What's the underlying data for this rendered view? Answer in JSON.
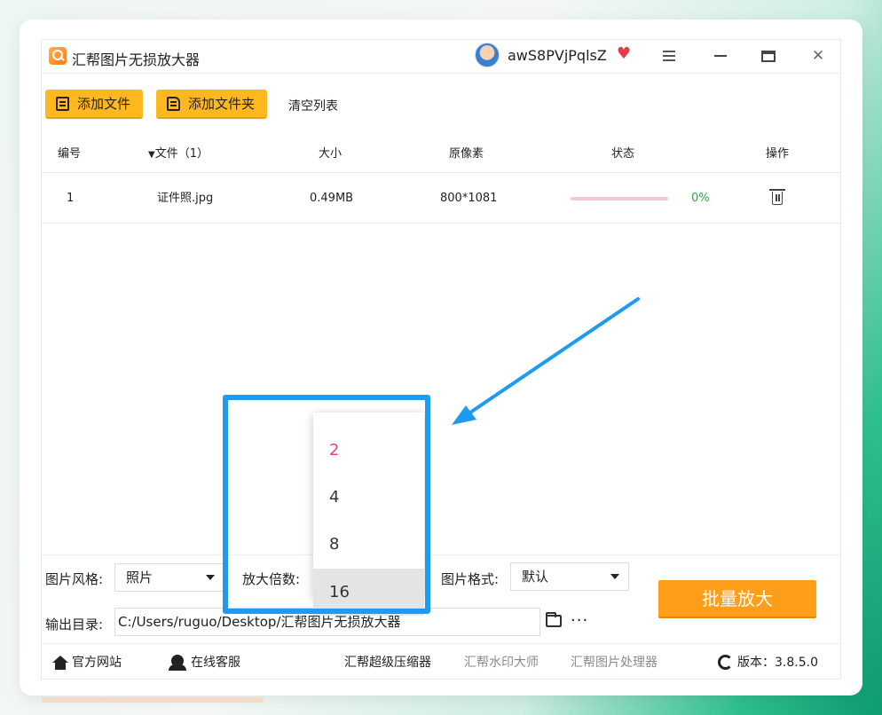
{
  "app": {
    "title": "汇帮图片无损放大器",
    "username": "awS8PVjPqlsZ"
  },
  "toolbar": {
    "add_file": "添加文件",
    "add_folder": "添加文件夹",
    "clear_list": "清空列表"
  },
  "table": {
    "headers": {
      "index": "编号",
      "file": "文件（1）",
      "size": "大小",
      "pixels": "原像素",
      "status": "状态",
      "action": "操作"
    },
    "rows": [
      {
        "index": "1",
        "file": "证件照.jpg",
        "size": "0.49MB",
        "pixels": "800*1081",
        "progress": 0,
        "progress_text": "0%"
      }
    ]
  },
  "settings": {
    "style_label": "图片风格:",
    "style_value": "照片",
    "scale_label": "放大倍数:",
    "format_label": "图片格式:",
    "format_value": "默认",
    "output_label": "输出目录:",
    "output_path": "C:/Users/ruguo/Desktop/汇帮图片无损放大器",
    "more": "···",
    "batch_button": "批量放大"
  },
  "dropdown": {
    "options": [
      "2",
      "4",
      "8",
      "16"
    ],
    "selected": "2",
    "hovered": "16"
  },
  "footer": {
    "website": "官方网站",
    "service": "在线客服",
    "compressor": "汇帮超级压缩器",
    "watermark": "汇帮水印大师",
    "image_processor": "汇帮图片处理器",
    "version": "版本：3.8.5.0"
  },
  "colors": {
    "accent_yellow": "#ffb81f",
    "batch_orange": "#ff9e1b",
    "highlight_blue": "#1d9bf0",
    "progress_pink": "#e6475f",
    "selected_option": "#e0457b"
  }
}
